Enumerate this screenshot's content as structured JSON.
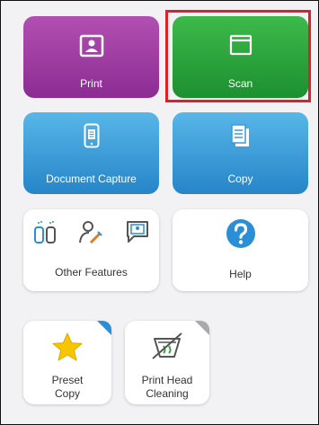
{
  "tiles": {
    "print": {
      "label": "Print"
    },
    "scan": {
      "label": "Scan"
    },
    "document_capture": {
      "label": "Document Capture"
    },
    "copy": {
      "label": "Copy"
    },
    "other_features": {
      "label": "Other Features"
    },
    "help": {
      "label": "Help"
    },
    "preset_copy": {
      "label_line1": "Preset",
      "label_line2": "Copy"
    },
    "print_head_cleaning": {
      "label_line1": "Print Head",
      "label_line2": "Cleaning"
    }
  },
  "colors": {
    "print": "#9b3aa1",
    "scan": "#2aa53c",
    "document_capture": "#3a9ad8",
    "copy": "#3a9ad8",
    "selection_outline": "#e51e25",
    "help_icon": "#2a8fd6",
    "star": "#f7c600"
  },
  "icons": {
    "print": "photo-frame-icon",
    "scan": "scanner-window-icon",
    "document_capture": "phone-document-icon",
    "copy": "documents-stack-icon",
    "other_features_1": "ink-bottles-icon",
    "other_features_2": "user-pen-icon",
    "other_features_3": "photo-chat-icon",
    "help": "question-mark-icon",
    "preset_copy": "star-icon",
    "print_head_cleaning": "nozzle-brush-icon"
  }
}
